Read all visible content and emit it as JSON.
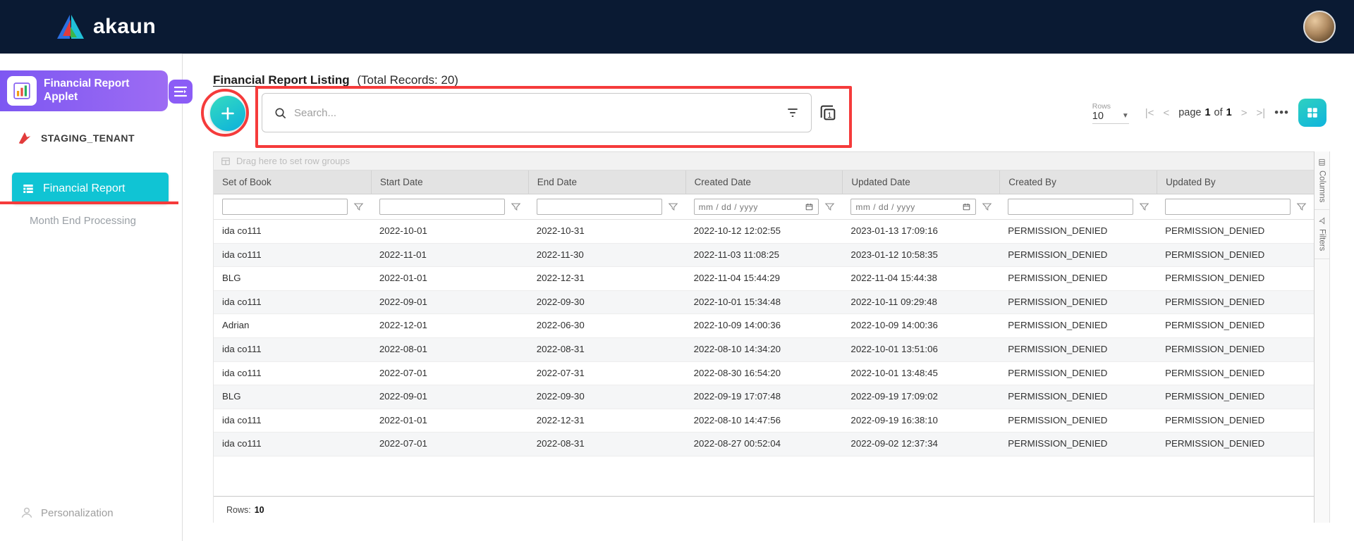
{
  "topbar": {
    "logo": "akaun"
  },
  "sidebar": {
    "applet_title": "Financial Report Applet",
    "tenant": "STAGING_TENANT",
    "nav_financial_report": "Financial Report",
    "nav_month_end": "Month End Processing",
    "personalization": "Personalization"
  },
  "toolbar": {
    "title": "Financial Report Listing",
    "total_records": "(Total Records: 20)",
    "search_placeholder": "Search...",
    "rows_label": "Rows",
    "rows_value": "10",
    "page_word": "page",
    "page_number": "1",
    "of_word": "of",
    "page_total": "1"
  },
  "table": {
    "drag_hint": "Drag here to set row groups",
    "columns": [
      "Set of Book",
      "Start Date",
      "End Date",
      "Created Date",
      "Updated Date",
      "Created By",
      "Updated By"
    ],
    "filter_types": [
      "text",
      "text",
      "text",
      "date",
      "date",
      "text",
      "text"
    ],
    "date_placeholder": "mm / dd / yyyy",
    "rows": [
      [
        "ida co111",
        "2022-10-01",
        "2022-10-31",
        "2022-10-12 12:02:55",
        "2023-01-13 17:09:16",
        "PERMISSION_DENIED",
        "PERMISSION_DENIED"
      ],
      [
        "ida co111",
        "2022-11-01",
        "2022-11-30",
        "2022-11-03 11:08:25",
        "2023-01-12 10:58:35",
        "PERMISSION_DENIED",
        "PERMISSION_DENIED"
      ],
      [
        "BLG",
        "2022-01-01",
        "2022-12-31",
        "2022-11-04 15:44:29",
        "2022-11-04 15:44:38",
        "PERMISSION_DENIED",
        "PERMISSION_DENIED"
      ],
      [
        "ida co111",
        "2022-09-01",
        "2022-09-30",
        "2022-10-01 15:34:48",
        "2022-10-11 09:29:48",
        "PERMISSION_DENIED",
        "PERMISSION_DENIED"
      ],
      [
        "Adrian",
        "2022-12-01",
        "2022-06-30",
        "2022-10-09 14:00:36",
        "2022-10-09 14:00:36",
        "PERMISSION_DENIED",
        "PERMISSION_DENIED"
      ],
      [
        "ida co111",
        "2022-08-01",
        "2022-08-31",
        "2022-08-10 14:34:20",
        "2022-10-01 13:51:06",
        "PERMISSION_DENIED",
        "PERMISSION_DENIED"
      ],
      [
        "ida co111",
        "2022-07-01",
        "2022-07-31",
        "2022-08-30 16:54:20",
        "2022-10-01 13:48:45",
        "PERMISSION_DENIED",
        "PERMISSION_DENIED"
      ],
      [
        "BLG",
        "2022-09-01",
        "2022-09-30",
        "2022-09-19 17:07:48",
        "2022-09-19 17:09:02",
        "PERMISSION_DENIED",
        "PERMISSION_DENIED"
      ],
      [
        "ida co111",
        "2022-01-01",
        "2022-12-31",
        "2022-08-10 14:47:56",
        "2022-09-19 16:38:10",
        "PERMISSION_DENIED",
        "PERMISSION_DENIED"
      ],
      [
        "ida co111",
        "2022-07-01",
        "2022-08-31",
        "2022-08-27 00:52:04",
        "2022-09-02 12:37:34",
        "PERMISSION_DENIED",
        "PERMISSION_DENIED"
      ]
    ],
    "footer_rows_label": "Rows:",
    "footer_rows_value": "10"
  },
  "side_tabs": {
    "columns": "Columns",
    "filters": "Filters"
  },
  "colors": {
    "topbar_navy": "#0a1a33",
    "accent_purple": "#8b5cf6",
    "accent_teal": "#10c4d4",
    "annotation_red": "#f53b3b"
  }
}
